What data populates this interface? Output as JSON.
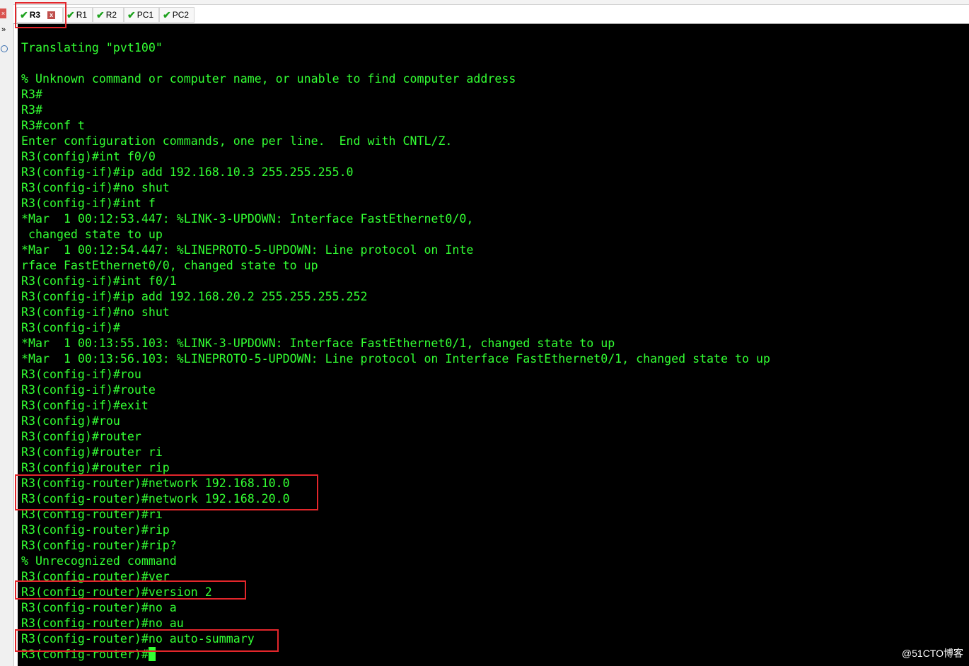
{
  "tabs": [
    {
      "label": "R3",
      "active": true
    },
    {
      "label": "R1",
      "active": false
    },
    {
      "label": "R2",
      "active": false
    },
    {
      "label": "PC1",
      "active": false
    },
    {
      "label": "PC2",
      "active": false
    }
  ],
  "terminal": {
    "lines": [
      "Translating \"pvt100\"",
      "",
      "% Unknown command or computer name, or unable to find computer address",
      "R3#",
      "R3#",
      "R3#conf t",
      "Enter configuration commands, one per line.  End with CNTL/Z.",
      "R3(config)#int f0/0",
      "R3(config-if)#ip add 192.168.10.3 255.255.255.0",
      "R3(config-if)#no shut",
      "R3(config-if)#int f",
      "*Mar  1 00:12:53.447: %LINK-3-UPDOWN: Interface FastEthernet0/0,",
      " changed state to up",
      "*Mar  1 00:12:54.447: %LINEPROTO-5-UPDOWN: Line protocol on Inte",
      "rface FastEthernet0/0, changed state to up",
      "R3(config-if)#int f0/1",
      "R3(config-if)#ip add 192.168.20.2 255.255.255.252",
      "R3(config-if)#no shut",
      "R3(config-if)#",
      "*Mar  1 00:13:55.103: %LINK-3-UPDOWN: Interface FastEthernet0/1, changed state to up",
      "*Mar  1 00:13:56.103: %LINEPROTO-5-UPDOWN: Line protocol on Interface FastEthernet0/1, changed state to up",
      "R3(config-if)#rou",
      "R3(config-if)#route",
      "R3(config-if)#exit",
      "R3(config)#rou",
      "R3(config)#router",
      "R3(config)#router ri",
      "R3(config)#router rip",
      "R3(config-router)#network 192.168.10.0",
      "R3(config-router)#network 192.168.20.0",
      "R3(config-router)#ri",
      "R3(config-router)#rip",
      "R3(config-router)#rip?",
      "% Unrecognized command",
      "R3(config-router)#ver",
      "R3(config-router)#version 2",
      "R3(config-router)#no a",
      "R3(config-router)#no au",
      "R3(config-router)#no auto-summary",
      "R3(config-router)#"
    ]
  },
  "watermark": "@51CTO博客",
  "colors": {
    "terminal_bg": "#000000",
    "terminal_text": "#33ff33",
    "highlight_box": "#e3262b",
    "tab_check": "#1fa21f"
  }
}
